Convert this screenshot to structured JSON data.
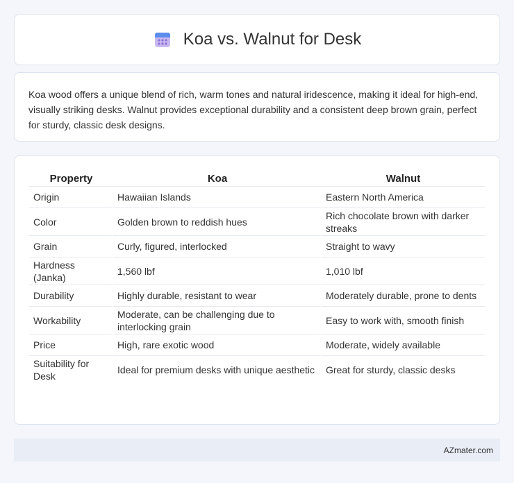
{
  "header": {
    "title": "Koa vs. Walnut for Desk",
    "icon": "calendar-icon"
  },
  "intro": {
    "text": "Koa wood offers a unique blend of rich, warm tones and natural iridescence, making it ideal for high-end, visually striking desks. Walnut provides exceptional durability and a consistent deep brown grain, perfect for sturdy, classic desk designs."
  },
  "table": {
    "headers": [
      "Property",
      "Koa",
      "Walnut"
    ],
    "rows": [
      [
        "Origin",
        "Hawaiian Islands",
        "Eastern North America"
      ],
      [
        "Color",
        "Golden brown to reddish hues",
        "Rich chocolate brown with darker streaks"
      ],
      [
        "Grain",
        "Curly, figured, interlocked",
        "Straight to wavy"
      ],
      [
        "Hardness (Janka)",
        "1,560 lbf",
        "1,010 lbf"
      ],
      [
        "Durability",
        "Highly durable, resistant to wear",
        "Moderately durable, prone to dents"
      ],
      [
        "Workability",
        "Moderate, can be challenging due to interlocking grain",
        "Easy to work with, smooth finish"
      ],
      [
        "Price",
        "High, rare exotic wood",
        "Moderate, widely available"
      ],
      [
        "Suitability for Desk",
        "Ideal for premium desks with unique aesthetic",
        "Great for sturdy, classic desks"
      ]
    ]
  },
  "footer": {
    "text": "AZmater.com"
  }
}
